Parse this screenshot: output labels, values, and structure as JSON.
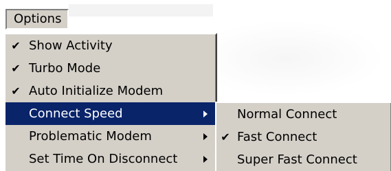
{
  "menubar": {
    "options_label": "Options"
  },
  "options_menu": {
    "items": [
      {
        "label": "Show Activity",
        "checked": true,
        "submenu": false
      },
      {
        "label": "Turbo Mode",
        "checked": true,
        "submenu": false
      },
      {
        "label": "Auto Initialize Modem",
        "checked": true,
        "submenu": false
      },
      {
        "label": "Connect Speed",
        "checked": false,
        "submenu": true,
        "highlighted": true
      },
      {
        "label": "Problematic Modem",
        "checked": false,
        "submenu": true
      },
      {
        "label": "Set Time On Disconnect",
        "checked": false,
        "submenu": true
      }
    ]
  },
  "connect_speed_submenu": {
    "items": [
      {
        "label": "Normal Connect",
        "checked": false
      },
      {
        "label": "Fast Connect",
        "checked": true
      },
      {
        "label": "Super Fast Connect",
        "checked": false
      }
    ]
  },
  "glyphs": {
    "check": "✔"
  },
  "colors": {
    "menu_face": "#d4d0c8",
    "highlight": "#0a246a",
    "highlight_text": "#ffffff"
  }
}
